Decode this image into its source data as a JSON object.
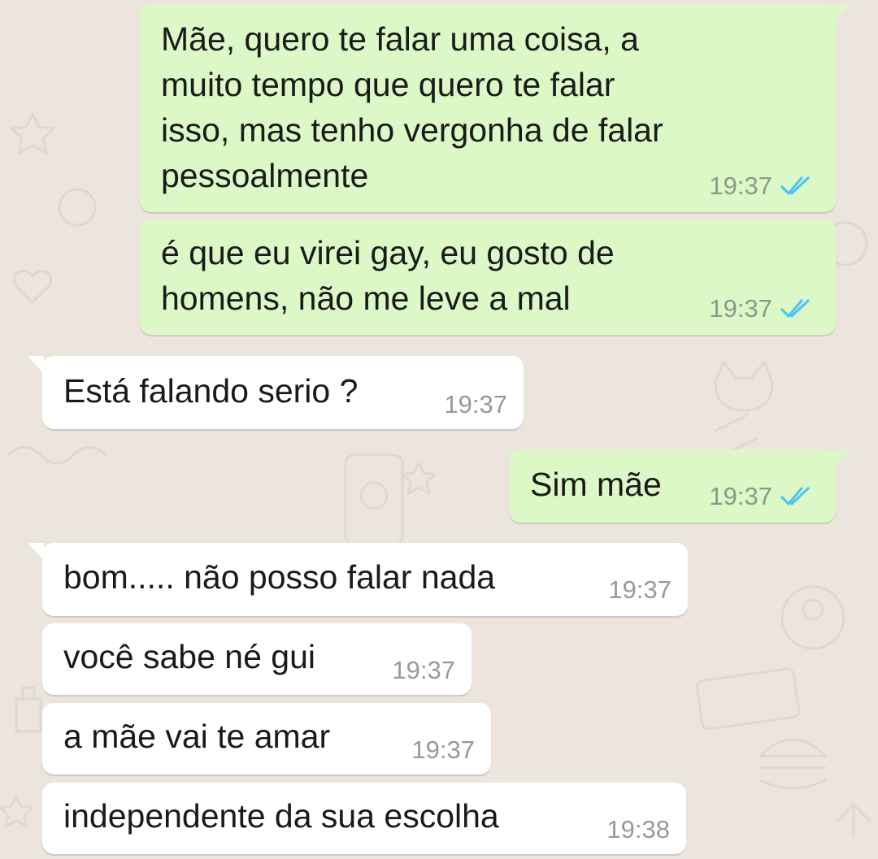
{
  "chat": {
    "messages": [
      {
        "direction": "outgoing",
        "lines": [
          "Mãe, quero te falar uma coisa, a",
          "muito tempo que quero te falar",
          "isso, mas tenho vergonha de falar",
          "pessoalmente"
        ],
        "time": "19:37",
        "status": "read"
      },
      {
        "direction": "outgoing",
        "lines": [
          "é que eu virei gay, eu gosto de",
          "homens, não me leve a mal"
        ],
        "time": "19:37",
        "status": "read"
      },
      {
        "direction": "incoming",
        "lines": [
          "Está falando serio ?"
        ],
        "time": "19:37"
      },
      {
        "direction": "outgoing",
        "lines": [
          "Sim mãe"
        ],
        "time": "19:37",
        "status": "read"
      },
      {
        "direction": "incoming",
        "lines": [
          "bom..... não posso falar nada"
        ],
        "time": "19:37"
      },
      {
        "direction": "incoming",
        "lines": [
          "você sabe né gui"
        ],
        "time": "19:37"
      },
      {
        "direction": "incoming",
        "lines": [
          "a mãe vai te amar"
        ],
        "time": "19:37"
      },
      {
        "direction": "incoming",
        "lines": [
          "independente da sua escolha"
        ],
        "time": "19:38"
      }
    ]
  },
  "colors": {
    "background": "#ece5dd",
    "outgoing_bubble": "#dcf8c6",
    "incoming_bubble": "#ffffff",
    "read_check": "#4fc3f7"
  },
  "icons": {
    "read_receipt": "double-check-icon"
  }
}
